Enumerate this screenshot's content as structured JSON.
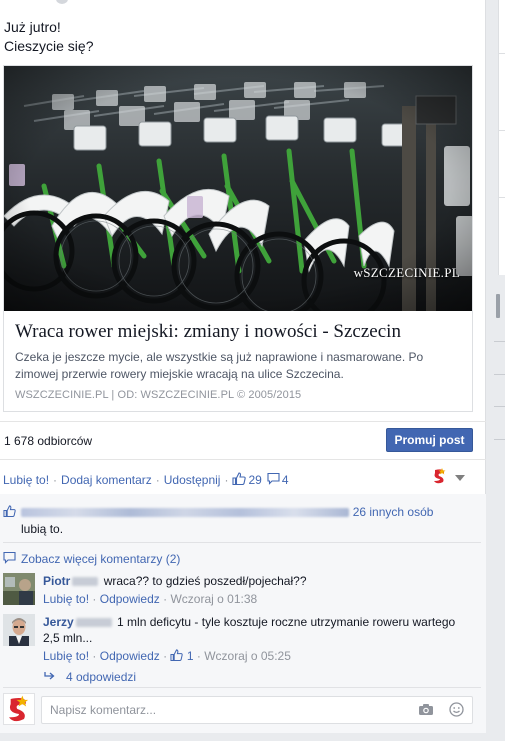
{
  "post": {
    "text_lines": [
      "Już jutro!",
      "Cieszycie się?"
    ],
    "link": {
      "watermark": "wSZCZECINIE.PL",
      "title": "Wraca rower miejski: zmiany i nowości - Szczecin",
      "description": "Czeka je jeszcze mycie, ale wszystkie są już naprawione i nasmarowane. Po zimowej przerwie rowery miejskie wracają na ulice Szczecina.",
      "source": "WSZCZECINIE.PL   |   OD: WSZCZECINIE.PL © 2005/2015"
    },
    "reach": "1 678 odbiorców",
    "promote_label": "Promuj post"
  },
  "actions": {
    "like": "Lubię to!",
    "comment": "Dodaj komentarz",
    "share": "Udostępnij",
    "like_count": "29",
    "comment_count": "4"
  },
  "likes_summary": {
    "others": "26 innych osób",
    "suffix": "lubią to."
  },
  "comments": {
    "more_label": "Zobacz więcej komentarzy (2)",
    "items": [
      {
        "author": "Piotr",
        "text": "wraca?? to gdzieś poszedł/pojechał??",
        "like": "Lubię to!",
        "reply": "Odpowiedz",
        "time": "Wczoraj o 01:38"
      },
      {
        "author": "Jerzy",
        "text": "1 mln deficytu - tyle kosztuje roczne utrzymanie roweru wartego 2,5 mln...",
        "like": "Lubię to!",
        "reply": "Odpowiedz",
        "likes": "1",
        "time": "Wczoraj o 05:25"
      }
    ],
    "replies_label": "4 odpowiedzi",
    "composer_placeholder": "Napisz komentarz..."
  },
  "colors": {
    "link_blue": "#4267b2",
    "button_blue": "#4267b2",
    "meta_gray": "#90949c",
    "comment_bg": "#f6f7f9",
    "bike_green": "#3fa23a"
  },
  "icons": [
    "thumbs-up-icon",
    "speech-bubble-icon",
    "page-logo-icon",
    "caret-down-icon",
    "reply-arrow-icon",
    "camera-icon",
    "smiley-icon"
  ]
}
